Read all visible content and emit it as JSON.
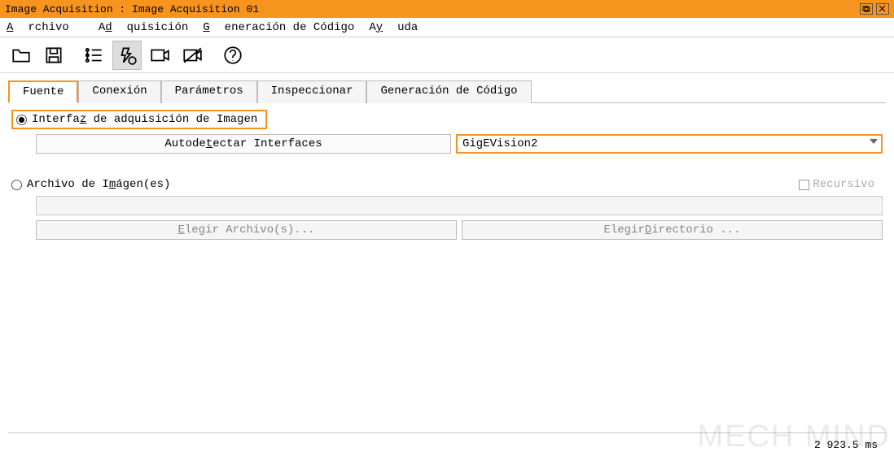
{
  "title": "Image Acquisition : Image Acquisition 01",
  "menu": {
    "archivo": "Archivo",
    "adquisicion": "Adquisición",
    "generacion": "Generación de Código",
    "ayuda": "Ayuda"
  },
  "tabs": {
    "fuente": "Fuente",
    "conexion": "Conexión",
    "parametros": "Parámetros",
    "inspeccionar": "Inspeccionar",
    "generacion": "Generación de Código"
  },
  "source": {
    "radio_interface": "Interfaz de adquisición de Imagen",
    "autodetect": "Autodetectar Interfaces",
    "selected_interface": "GigEVision2",
    "radio_file": "Archivo de Imágen(es)",
    "recursive": "Recursivo",
    "choose_file": "Elegir Archivo(s)...",
    "choose_dir": "Elegir Directorio ..."
  },
  "status": {
    "text": "2  923.5 ms"
  },
  "watermark": "MECH MIND"
}
